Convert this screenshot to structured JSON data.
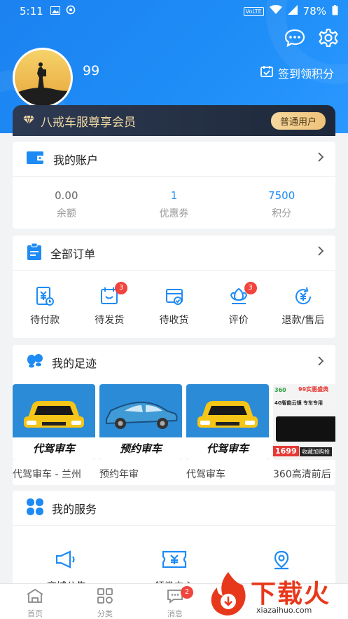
{
  "status_bar": {
    "time": "5:11",
    "network": "VoLTE",
    "battery": "78%"
  },
  "profile": {
    "username": "99",
    "signin_label": "签到领积分"
  },
  "member": {
    "title": "八戒车服尊享会员",
    "badge": "普通用户"
  },
  "account": {
    "title": "我的账户",
    "stats": [
      {
        "value": "0.00",
        "label": "余额"
      },
      {
        "value": "1",
        "label": "优惠券"
      },
      {
        "value": "7500",
        "label": "积分"
      }
    ]
  },
  "orders": {
    "title": "全部订单",
    "items": [
      {
        "label": "待付款",
        "icon": "pending-payment-icon",
        "badge": ""
      },
      {
        "label": "待发货",
        "icon": "pending-shipment-icon",
        "badge": "3"
      },
      {
        "label": "待收货",
        "icon": "pending-receipt-icon",
        "badge": ""
      },
      {
        "label": "评价",
        "icon": "review-icon",
        "badge": "3"
      },
      {
        "label": "退款/售后",
        "icon": "refund-icon",
        "badge": ""
      }
    ]
  },
  "footprints": {
    "title": "我的足迹",
    "items": [
      {
        "caption": "代驾审车 - 兰州",
        "banner": "代驾审车"
      },
      {
        "caption": "预约年审",
        "banner": "预约审车"
      },
      {
        "caption": "代驾审车",
        "banner": "代驾审车"
      },
      {
        "caption": "360高清前后",
        "banner": ""
      }
    ],
    "product_ad": {
      "brand": "360",
      "tag": "99实惠盛典",
      "headline": "4G智能云镜 专车专用",
      "price": "1699",
      "cta": "收藏加购抢"
    }
  },
  "services": {
    "title": "我的服务",
    "items": [
      {
        "label": "商城公告",
        "icon": "megaphone-icon"
      },
      {
        "label": "领券中心",
        "icon": "coupon-icon"
      },
      {
        "label": "",
        "icon": "location-icon"
      }
    ]
  },
  "tabbar": {
    "items": [
      {
        "label": "首页",
        "icon": "home-icon"
      },
      {
        "label": "分类",
        "icon": "category-icon"
      },
      {
        "label": "消息",
        "icon": "message-icon",
        "badge": "2"
      }
    ]
  },
  "watermark": {
    "text": "下载火",
    "url": "xiazaihuo.com"
  },
  "colors": {
    "primary": "#1e8bf5",
    "member_bg": "#2d3a52",
    "gold": "#f1d7a3",
    "badge_red": "#f0443c",
    "car_yellow": "#f5c518"
  }
}
